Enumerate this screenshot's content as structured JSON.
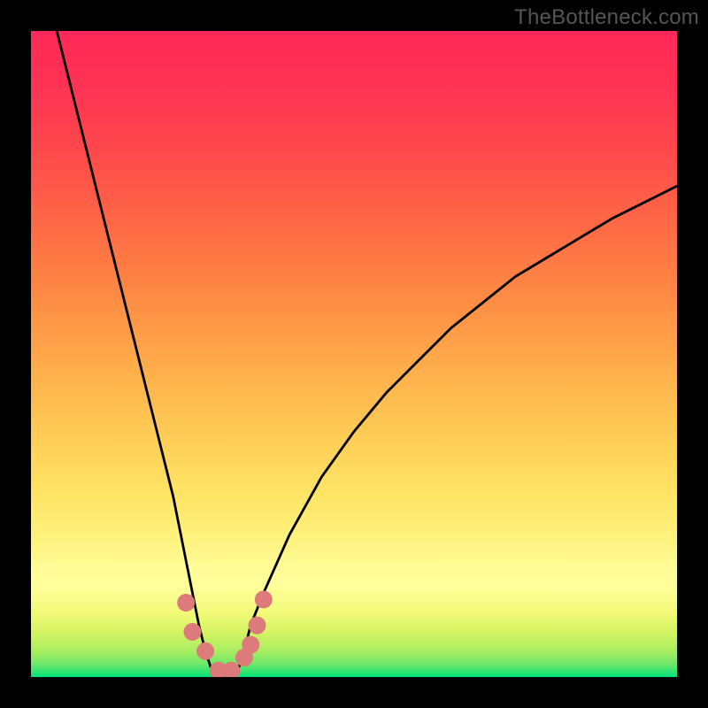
{
  "watermark": "TheBottleneck.com",
  "chart_data": {
    "type": "line",
    "title": "",
    "xlabel": "",
    "ylabel": "",
    "xlim": [
      0,
      100
    ],
    "ylim": [
      0,
      100
    ],
    "grid": false,
    "series": [
      {
        "name": "bottleneck-curve",
        "x": [
          4,
          6,
          8,
          10,
          12,
          14,
          16,
          18,
          20,
          22,
          24,
          25,
          26,
          27,
          28,
          29,
          30,
          31,
          32,
          33,
          34,
          36,
          40,
          45,
          50,
          55,
          60,
          65,
          70,
          75,
          80,
          85,
          90,
          95,
          100
        ],
        "values": [
          100,
          92,
          84,
          76,
          68,
          60,
          52,
          44,
          36,
          28,
          18,
          13,
          8,
          4,
          1,
          0,
          0,
          0,
          1,
          4,
          8,
          13,
          22,
          31,
          38,
          44,
          49,
          54,
          58,
          62,
          65,
          68,
          71,
          73.5,
          76
        ]
      },
      {
        "name": "bottom-markers",
        "type": "scatter",
        "x": [
          24,
          25,
          27,
          29,
          31,
          33,
          34,
          35,
          36
        ],
        "values": [
          11.5,
          7,
          4,
          1,
          1,
          3,
          5,
          8,
          12
        ],
        "color": "#dd7a7a"
      }
    ],
    "gradient_stops": [
      {
        "pct": 0,
        "color": "#00e37a"
      },
      {
        "pct": 4,
        "color": "#a8ee61"
      },
      {
        "pct": 10,
        "color": "#f3fa79"
      },
      {
        "pct": 14,
        "color": "#ffff9b"
      },
      {
        "pct": 28,
        "color": "#fee566"
      },
      {
        "pct": 45,
        "color": "#feb64d"
      },
      {
        "pct": 63,
        "color": "#fe7e44"
      },
      {
        "pct": 81,
        "color": "#fe4a4b"
      },
      {
        "pct": 100,
        "color": "#ff2858"
      }
    ]
  }
}
